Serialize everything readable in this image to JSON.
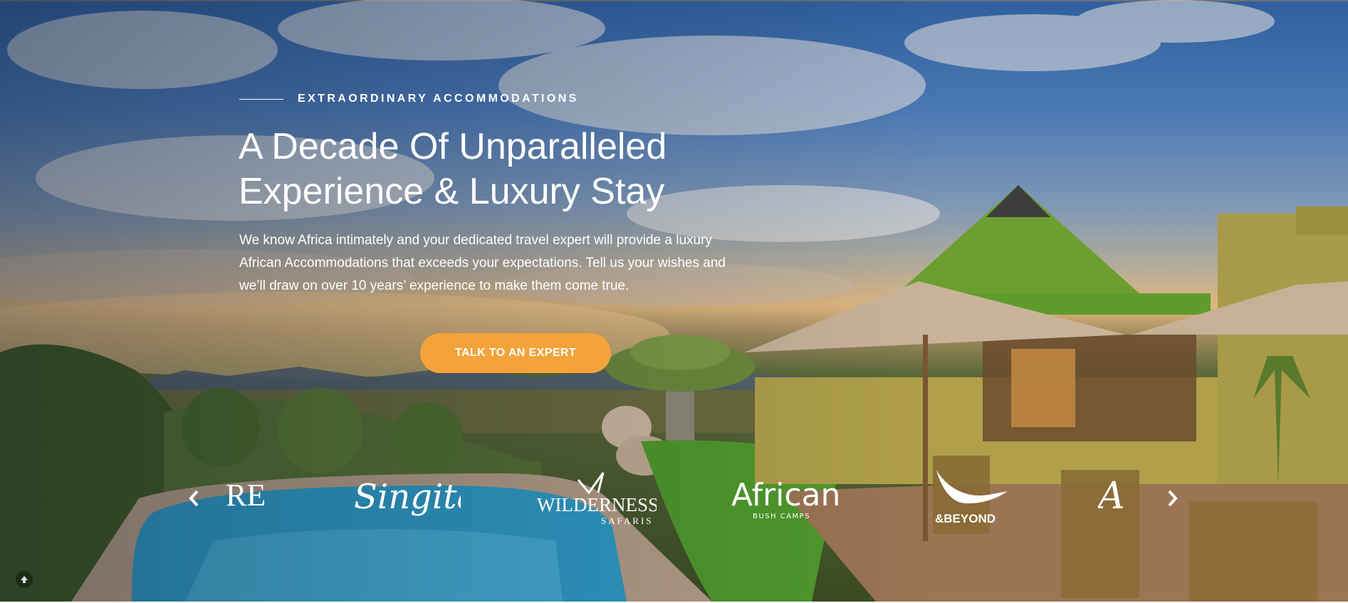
{
  "hero": {
    "eyebrow": "EXTRAORDINARY ACCOMMODATIONS",
    "headline_lines": [
      "A Decade Of Unparalleled",
      "Experience & Luxury Stay"
    ],
    "intro_lines": [
      "We know Africa intimately and your dedicated travel expert will provide a luxury",
      "African Accommodations that exceeds your expectations. Tell us your wishes and",
      "we’ll draw on over 10 years’ experience to make them come true."
    ],
    "cta_label": "TALK TO AN EXPERT",
    "cta_color": "#f4a33a"
  },
  "partners": {
    "logos": [
      {
        "name": "RE",
        "icon": "partial-logo"
      },
      {
        "name": "Singita",
        "icon": "singita-logo"
      },
      {
        "name": "WILDERNESS",
        "sub": "SAFARIS",
        "icon": "wilderness-safaris-logo"
      },
      {
        "name": "African",
        "sub": "BUSH CAMPS",
        "icon": "african-bush-camps-logo"
      },
      {
        "name": "&BEYOND",
        "icon": "andbeyond-logo"
      },
      {
        "name": "A",
        "icon": "partial-logo"
      }
    ],
    "prev_icon": "chevron-left-icon",
    "next_icon": "chevron-right-icon"
  },
  "utility": {
    "scroll_top_icon": "arrow-up-circle-icon"
  }
}
